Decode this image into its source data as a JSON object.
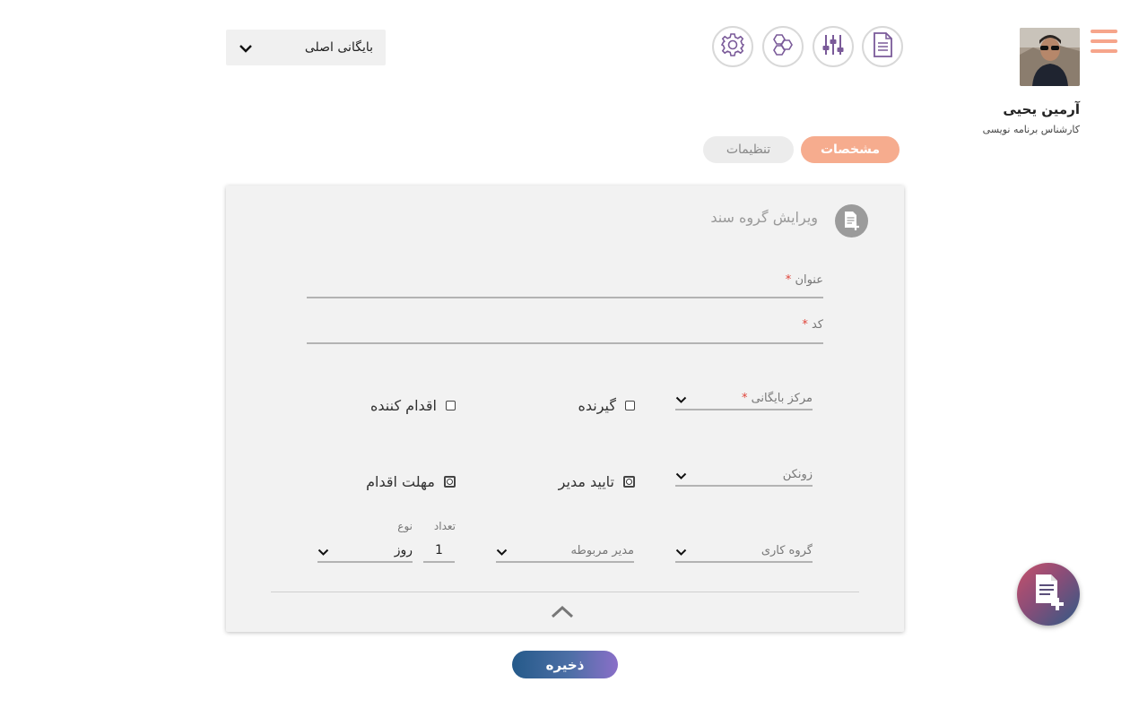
{
  "header": {
    "archive_select": {
      "value": "بایگانی اصلی"
    },
    "icons": [
      "settings-gear-icon",
      "hexagons-icon",
      "sliders-icon",
      "document-icon"
    ]
  },
  "user": {
    "name": "آرمین یحیی",
    "role": "کارشناس برنامه نویسی"
  },
  "tabs": [
    {
      "label": "مشخصات",
      "active": true
    },
    {
      "label": "تنظیمات",
      "active": false
    }
  ],
  "form": {
    "title": "ویرایش گروه سند",
    "fields": {
      "title": {
        "label": "عنوان",
        "required": true,
        "value": ""
      },
      "code": {
        "label": "کد",
        "required": true,
        "value": ""
      }
    },
    "archive_center": {
      "label": "مرکز بایگانی",
      "required": true
    },
    "zonkan": {
      "label": "زونکن"
    },
    "workgroup": {
      "label": "گروه کاری"
    },
    "manager": {
      "label": "مدیر مربوطه"
    },
    "deadline_count": {
      "label": "تعداد",
      "value": "1"
    },
    "deadline_type": {
      "label": "نوع",
      "value": "روز"
    },
    "checkboxes": {
      "receiver": "گیرنده",
      "actor": "اقدام کننده",
      "manager_approval": "تایید مدیر",
      "action_deadline": "مهلت اقدام"
    },
    "save_label": "ذخیره"
  },
  "colors": {
    "accent": "#f6ac8e",
    "hamburger": "#f6a58b",
    "save_gradient_start": "#255a8a",
    "save_gradient_end": "#8a6fc8",
    "required": "#e0443a"
  }
}
